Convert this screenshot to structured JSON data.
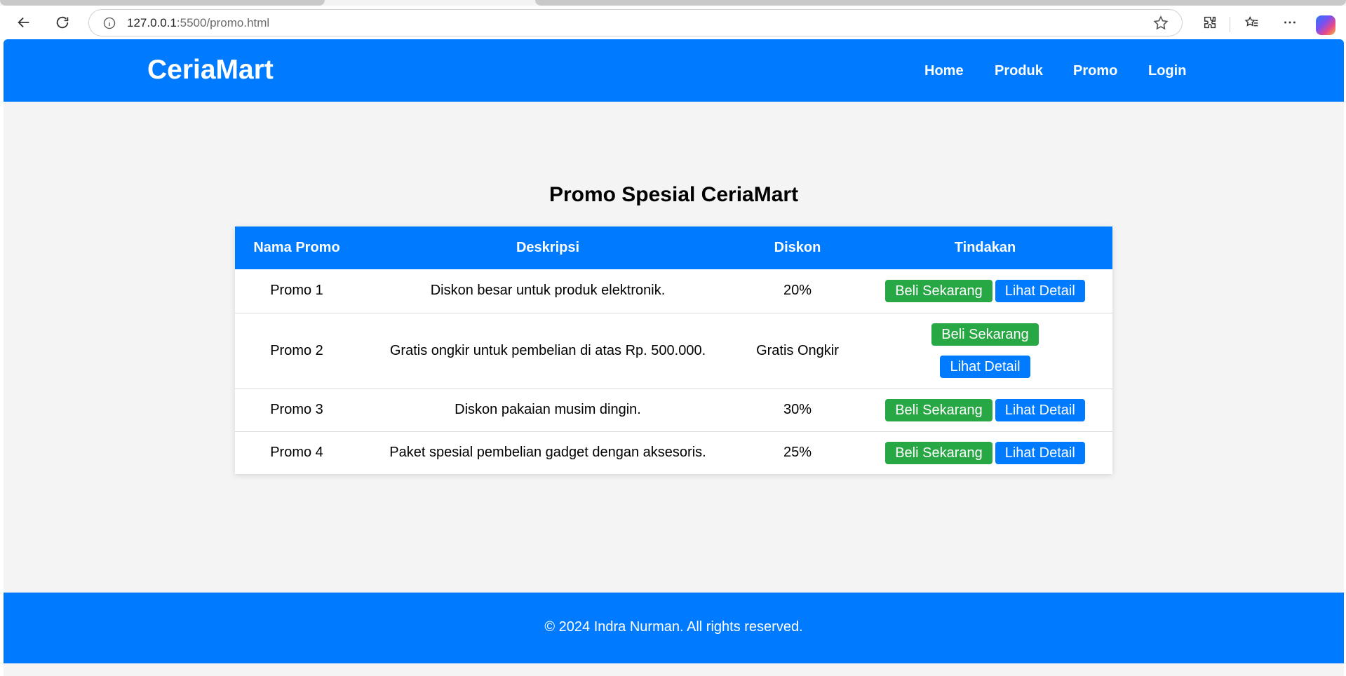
{
  "browser": {
    "url_host": "127.0.0.1",
    "url_rest": ":5500/promo.html"
  },
  "header": {
    "logo": "CeriaMart",
    "nav": [
      "Home",
      "Produk",
      "Promo",
      "Login"
    ]
  },
  "main": {
    "title": "Promo Spesial CeriaMart",
    "table": {
      "headers": [
        "Nama Promo",
        "Deskripsi",
        "Diskon",
        "Tindakan"
      ],
      "rows": [
        {
          "name": "Promo 1",
          "description": "Diskon besar untuk produk elektronik.",
          "discount": "20%"
        },
        {
          "name": "Promo 2",
          "description": "Gratis ongkir untuk pembelian di atas Rp. 500.000.",
          "discount": "Gratis Ongkir"
        },
        {
          "name": "Promo 3",
          "description": "Diskon pakaian musim dingin.",
          "discount": "30%"
        },
        {
          "name": "Promo 4",
          "description": "Paket spesial pembelian gadget dengan aksesoris.",
          "discount": "25%"
        }
      ],
      "buy_label": "Beli Sekarang",
      "detail_label": "Lihat Detail"
    }
  },
  "footer": {
    "text": "© 2024 Indra Nurman. All rights reserved."
  },
  "colors": {
    "primary": "#007bff",
    "success": "#28a745",
    "background": "#f4f4f4"
  }
}
